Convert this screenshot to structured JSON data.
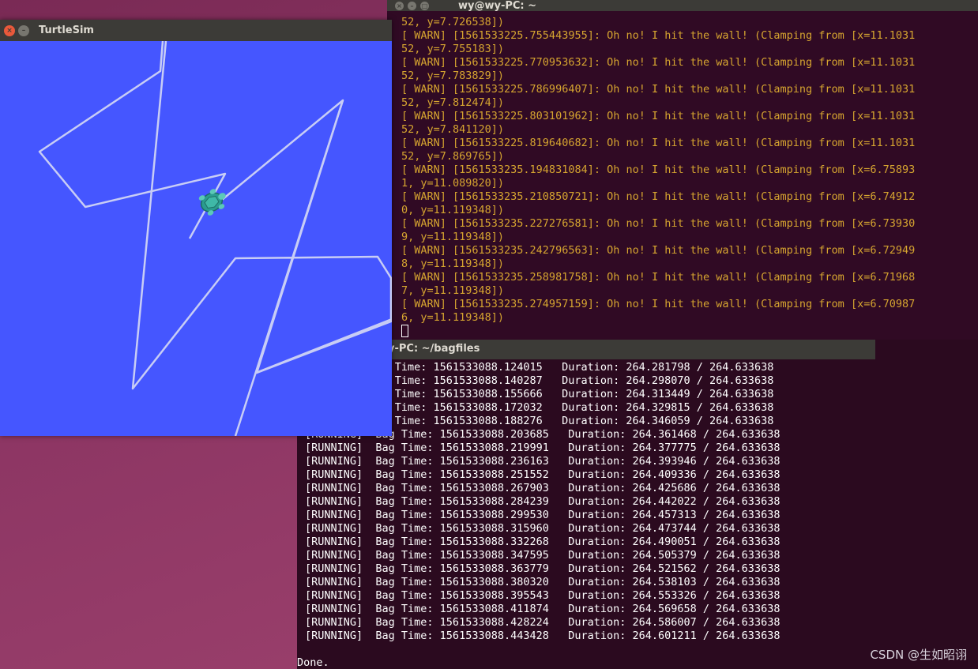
{
  "term1": {
    "title": "wy@wy-PC: ~",
    "lines": [
      "52, y=7.726538])",
      "[ WARN] [1561533225.755443955]: Oh no! I hit the wall! (Clamping from [x=11.1031",
      "52, y=7.755183])",
      "[ WARN] [1561533225.770953632]: Oh no! I hit the wall! (Clamping from [x=11.1031",
      "52, y=7.783829])",
      "[ WARN] [1561533225.786996407]: Oh no! I hit the wall! (Clamping from [x=11.1031",
      "52, y=7.812474])",
      "[ WARN] [1561533225.803101962]: Oh no! I hit the wall! (Clamping from [x=11.1031",
      "52, y=7.841120])",
      "[ WARN] [1561533225.819640682]: Oh no! I hit the wall! (Clamping from [x=11.1031",
      "52, y=7.869765])",
      "[ WARN] [1561533235.194831084]: Oh no! I hit the wall! (Clamping from [x=6.75893",
      "1, y=11.089820])",
      "[ WARN] [1561533235.210850721]: Oh no! I hit the wall! (Clamping from [x=6.74912",
      "0, y=11.119348])",
      "[ WARN] [1561533235.227276581]: Oh no! I hit the wall! (Clamping from [x=6.73930",
      "9, y=11.119348])",
      "[ WARN] [1561533235.242796563]: Oh no! I hit the wall! (Clamping from [x=6.72949",
      "8, y=11.119348])",
      "[ WARN] [1561533235.258981758]: Oh no! I hit the wall! (Clamping from [x=6.71968",
      "7, y=11.119348])",
      "[ WARN] [1561533235.274957159]: Oh no! I hit the wall! (Clamping from [x=6.70987",
      "6, y=11.119348])"
    ]
  },
  "term2": {
    "title": "y-PC: ~/bagfiles",
    "lines": [
      "          Bag Time: 1561533088.124015   Duration: 264.281798 / 264.633638",
      "          Bag Time: 1561533088.140287   Duration: 264.298070 / 264.633638",
      "          Bag Time: 1561533088.155666   Duration: 264.313449 / 264.633638",
      "          Bag Time: 1561533088.172032   Duration: 264.329815 / 264.633638",
      "          Bag Time: 1561533088.188276   Duration: 264.346059 / 264.633638",
      "[RUNNING]  Bag Time: 1561533088.203685   Duration: 264.361468 / 264.633638",
      "[RUNNING]  Bag Time: 1561533088.219991   Duration: 264.377775 / 264.633638",
      "[RUNNING]  Bag Time: 1561533088.236163   Duration: 264.393946 / 264.633638",
      "[RUNNING]  Bag Time: 1561533088.251552   Duration: 264.409336 / 264.633638",
      "[RUNNING]  Bag Time: 1561533088.267903   Duration: 264.425686 / 264.633638",
      "[RUNNING]  Bag Time: 1561533088.284239   Duration: 264.442022 / 264.633638",
      "[RUNNING]  Bag Time: 1561533088.299530   Duration: 264.457313 / 264.633638",
      "[RUNNING]  Bag Time: 1561533088.315960   Duration: 264.473744 / 264.633638",
      "[RUNNING]  Bag Time: 1561533088.332268   Duration: 264.490051 / 264.633638",
      "[RUNNING]  Bag Time: 1561533088.347595   Duration: 264.505379 / 264.633638",
      "[RUNNING]  Bag Time: 1561533088.363779   Duration: 264.521562 / 264.633638",
      "[RUNNING]  Bag Time: 1561533088.380320   Duration: 264.538103 / 264.633638",
      "[RUNNING]  Bag Time: 1561533088.395543   Duration: 264.553326 / 264.633638",
      "[RUNNING]  Bag Time: 1561533088.411874   Duration: 264.569658 / 264.633638",
      "[RUNNING]  Bag Time: 1561533088.428224   Duration: 264.586007 / 264.633638",
      "[RUNNING]  Bag Time: 1561533088.443428   Duration: 264.601211 / 264.633638"
    ],
    "done": "Done."
  },
  "turtlesim": {
    "title": "TurtleSim",
    "background": "#4556ff",
    "trail_color": "#c8cdf5"
  },
  "watermark": "CSDN @生如昭诩"
}
